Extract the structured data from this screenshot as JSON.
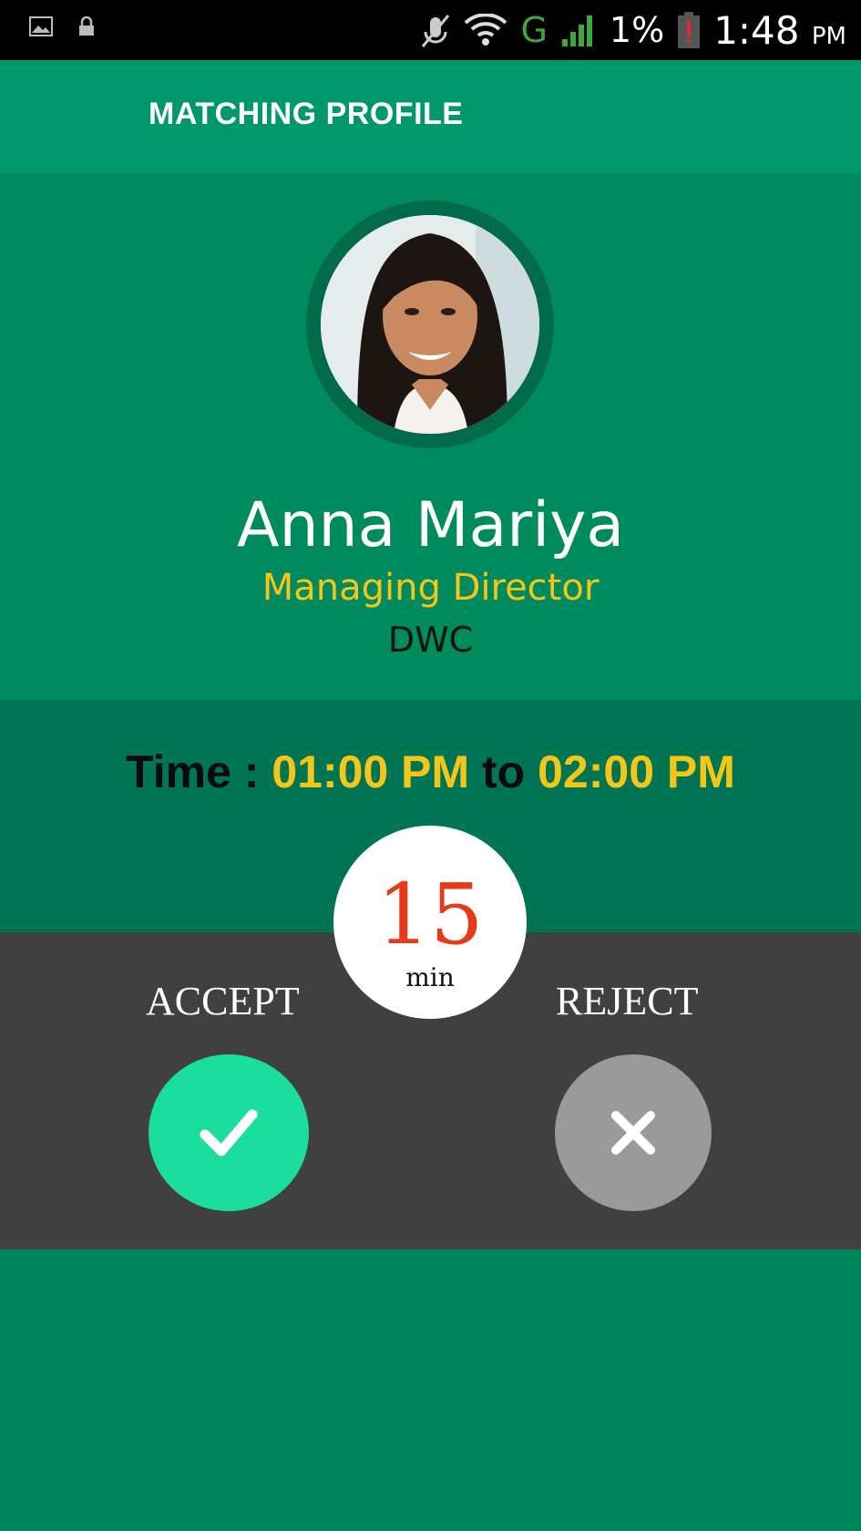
{
  "status_bar": {
    "icons": [
      "image-icon",
      "lock-icon",
      "mute-icon",
      "wifi-icon",
      "signal-icon",
      "battery-alert-icon"
    ],
    "network": "G",
    "battery": "1%",
    "time": "1:48",
    "ampm": "PM"
  },
  "header": {
    "title": "MATCHING PROFILE"
  },
  "profile": {
    "name": "Anna Mariya",
    "role": "Managing Director",
    "company": "DWC"
  },
  "schedule": {
    "prefix": "Time :",
    "start": "01:00 PM",
    "joiner": "to",
    "end": "02:00 PM"
  },
  "timer": {
    "value": "15",
    "unit": "min"
  },
  "actions": {
    "accept_label": "ACCEPT",
    "reject_label": "REJECT"
  },
  "colors": {
    "header_bg": "#00976a",
    "profile_bg": "#008b5e",
    "time_bg": "#007553",
    "action_bg": "#404040",
    "accent_yellow": "#f5c518",
    "accept_green": "#1bdd9e",
    "reject_grey": "#9a9a9a",
    "timer_red": "#e63a1b"
  }
}
